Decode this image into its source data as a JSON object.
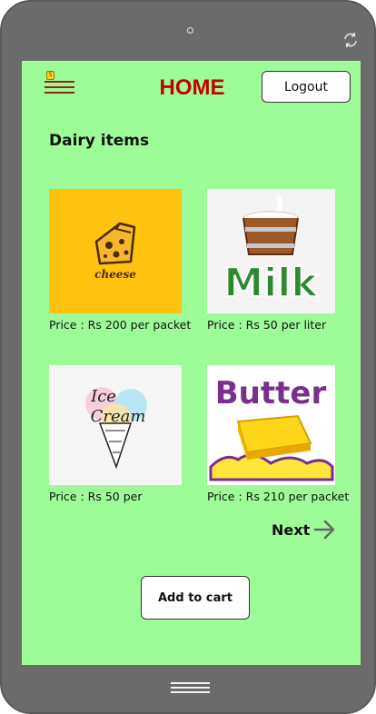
{
  "header": {
    "title": "HOME",
    "logout_label": "Logout",
    "menu_badge": "5"
  },
  "section": {
    "title": "Dairy items"
  },
  "products": [
    {
      "name": "cheese",
      "image_text": "cheese",
      "price": "Price : Rs 200 per packet"
    },
    {
      "name": "milk",
      "image_text": "Milk",
      "price": "Price : Rs 50 per liter"
    },
    {
      "name": "ice-cream",
      "image_text_1": "Ice",
      "image_text_2": "Cream",
      "price": "Price : Rs 50 per"
    },
    {
      "name": "butter",
      "image_text": "Butter",
      "price": "Price : Rs 210 per packet"
    }
  ],
  "actions": {
    "next_label": "Next",
    "add_to_cart_label": "Add to cart"
  },
  "icons": {
    "menu": "hamburger-menu-icon",
    "next": "arrow-right-icon",
    "rotate": "rotate-icon",
    "home": "home-bar-icon"
  },
  "colors": {
    "screen_background": "#9dfc98",
    "title": "#c30000",
    "device_frame": "#6b6b6b"
  }
}
